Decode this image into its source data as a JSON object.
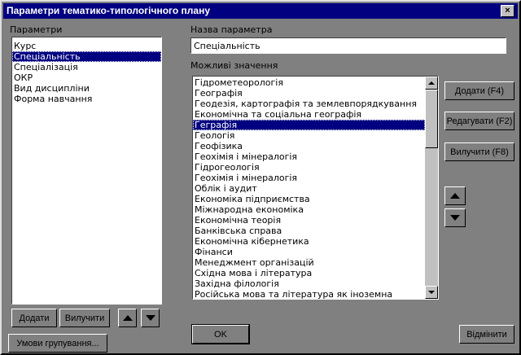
{
  "window": {
    "title": "Параметри тематико-типологічного плану",
    "close_glyph": "×"
  },
  "params": {
    "label": "Параметри",
    "items": [
      "Курс",
      "Спеціальність",
      "Спеціалізація",
      "ОКР",
      "Вид дисципліни",
      "Форма навчання"
    ],
    "selected_index": 1,
    "add_label": "Додати",
    "remove_label": "Вилучити",
    "group_label": "Умови групування..."
  },
  "param_name": {
    "label": "Назва параметра",
    "value": "Спеціальність"
  },
  "values": {
    "label": "Можливі значення",
    "items": [
      "Гідрометеорологія",
      "Географія",
      "Геодезія, картографія та землевпорядкування",
      "Економічна та соціальна географія",
      "Геграфія",
      "Геологія",
      "Геофізика",
      "Геохімія і мінералогія",
      "Гідрогеологія",
      "Геохімія і мінералогія",
      "Облік і аудит",
      "Економіка підприємства",
      "Міжнародна економіка",
      "Економічна теорія",
      "Банківська справа",
      "Економічна кібернетика",
      "Фінанси",
      "Менеджмент організацій",
      "Східна мова і література",
      "Західна філологія",
      "Російська мова та література як іноземна"
    ],
    "selected_index": 4,
    "add_label": "Додати (F4)",
    "edit_label": "Редагувати (F2)",
    "remove_label": "Вилучити (F8)"
  },
  "footer": {
    "ok_label": "OK",
    "cancel_label": "Відмінити"
  }
}
